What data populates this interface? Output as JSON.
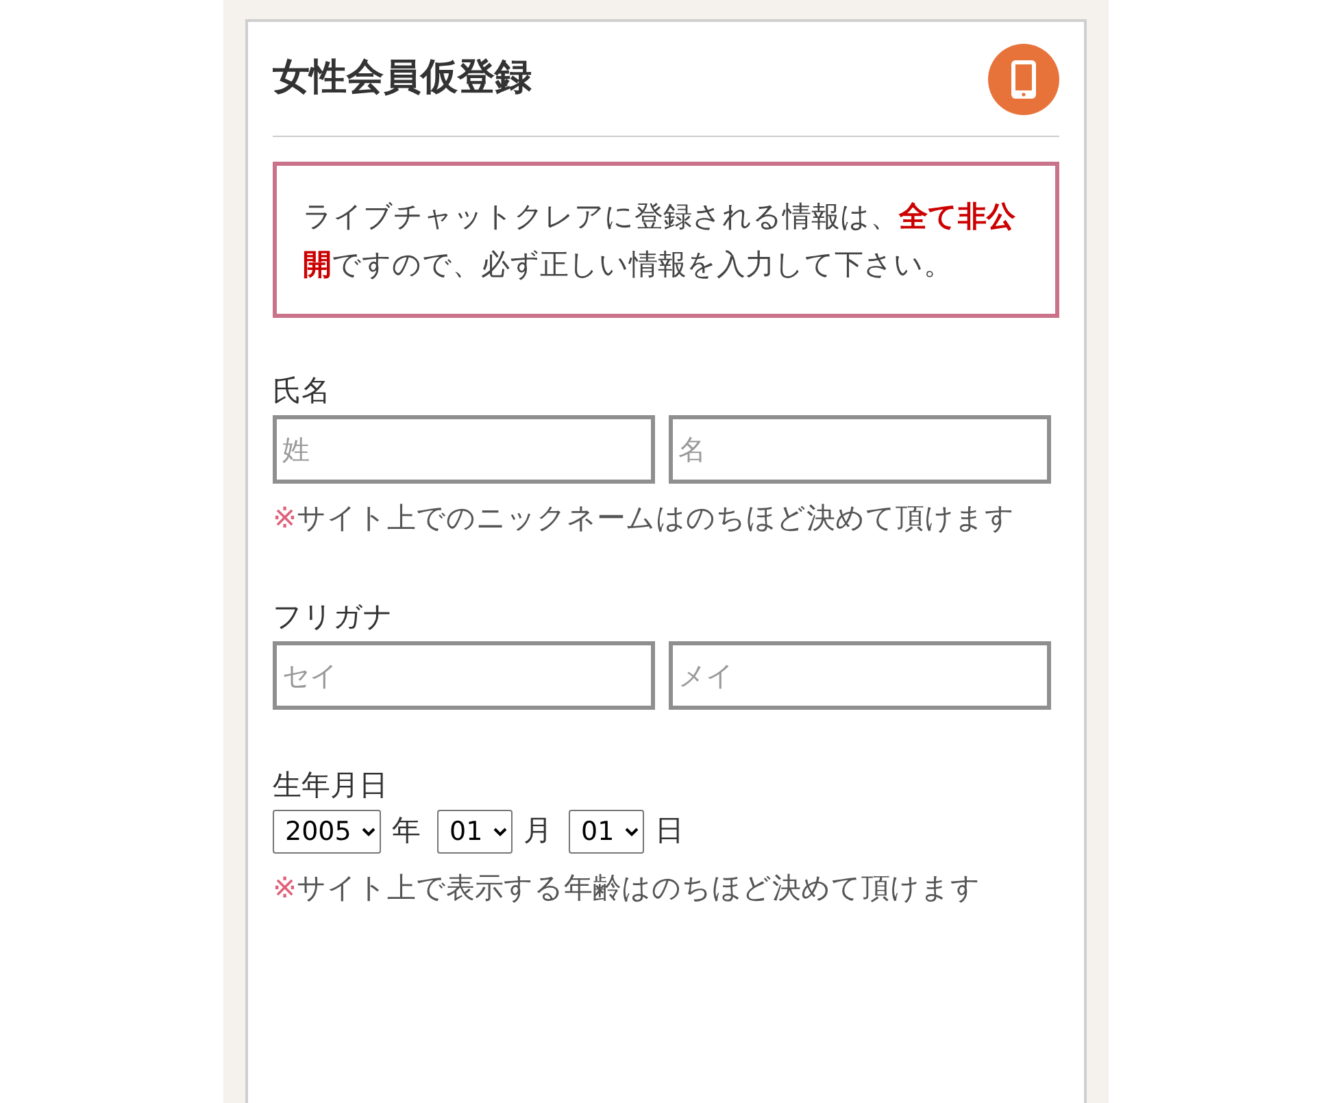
{
  "title": "女性会員仮登録",
  "notice": "ライブチャットクレアに登録される情報は、**全て非公開**ですので、必ず正しい情報を入力して下さい。",
  "sections": [
    {
      "kind": "pair",
      "label": "氏名",
      "fields": [
        {
          "placeholder": "姓"
        },
        {
          "placeholder": "名"
        }
      ],
      "note": {
        "mark": "※",
        "text": "サイト上でのニックネームはのちほど決めて頂けます"
      }
    },
    {
      "kind": "pair",
      "label": "フリガナ",
      "fields": [
        {
          "placeholder": "セイ"
        },
        {
          "placeholder": "メイ"
        }
      ]
    },
    {
      "kind": "date",
      "label": "生年月日",
      "selects": [
        {
          "value": "2005",
          "unit": "年"
        },
        {
          "value": "01",
          "unit": "月"
        },
        {
          "value": "01",
          "unit": "日"
        }
      ],
      "note": {
        "mark": "※",
        "text": "サイト上で表示する年齢はのちほど決めて頂けます"
      }
    }
  ]
}
